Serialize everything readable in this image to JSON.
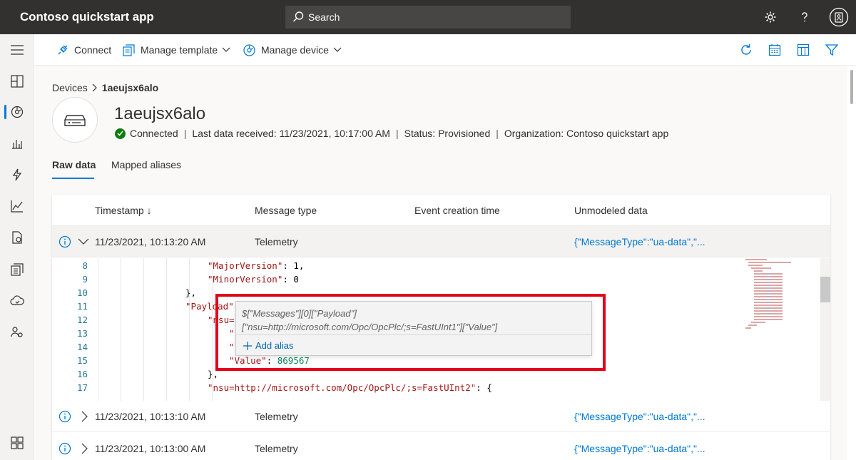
{
  "app": {
    "title": "Contoso quickstart app"
  },
  "search": {
    "placeholder": "Search"
  },
  "toolbar": {
    "connect": "Connect",
    "manage_template": "Manage template",
    "manage_device": "Manage device"
  },
  "breadcrumb": {
    "root": "Devices",
    "current": "1aeujsx6alo"
  },
  "device": {
    "name": "1aeujsx6alo",
    "status": "Connected",
    "last_data": "Last data received: 11/23/2021, 10:17:00 AM",
    "provisioning": "Status: Provisioned",
    "organization": "Organization: Contoso quickstart app",
    "status_color": "#107c10"
  },
  "tabs": [
    {
      "label": "Raw data",
      "active": true
    },
    {
      "label": "Mapped aliases",
      "active": false
    }
  ],
  "table": {
    "headers": [
      "Timestamp ↓",
      "Message type",
      "Event creation time",
      "Unmodeled data"
    ],
    "rows": [
      {
        "timestamp": "11/23/2021, 10:13:20 AM",
        "type": "Telemetry",
        "data": "{\"MessageType\":\"ua-data\",\"..."
      },
      {
        "timestamp": "11/23/2021, 10:13:10 AM",
        "type": "Telemetry",
        "data": "{\"MessageType\":\"ua-data\",\"..."
      },
      {
        "timestamp": "11/23/2021, 10:13:00 AM",
        "type": "Telemetry",
        "data": "{\"MessageType\":\"ua-data\",\"..."
      }
    ]
  },
  "code": {
    "line_numbers": [
      "8",
      "9",
      "10",
      "11",
      "12",
      "13",
      "14",
      "15",
      "16",
      "17"
    ],
    "lines": {
      "l8_key": "\"MajorVersion\"",
      "l8_rest": ": 1,",
      "l9_key": "\"MinorVersion\"",
      "l9_rest": ": 0",
      "l10": "},",
      "l11_key": "\"Payload\"",
      "l12_key": "\"nsu=",
      "l13": "\"",
      "l14": "\"",
      "l15_key": "\"Value\"",
      "l15_sep": ": ",
      "l15_val": "869567",
      "l16": "},",
      "l17_key": "\"nsu=http://microsoft.com/Opc/OpcPlc/;s=FastUInt2\"",
      "l17_rest": ": {"
    }
  },
  "hover": {
    "path_line1": "$[\"Messages\"][0][\"Payload\"]",
    "path_line2": "[\"nsu=http://microsoft.com/Opc/OpcPlc/;s=FastUInt1\"][\"Value\"]",
    "add_alias": "Add alias"
  },
  "colors": {
    "accent": "#0078d4",
    "highlight": "#e3001b",
    "topbar": "#323130"
  }
}
